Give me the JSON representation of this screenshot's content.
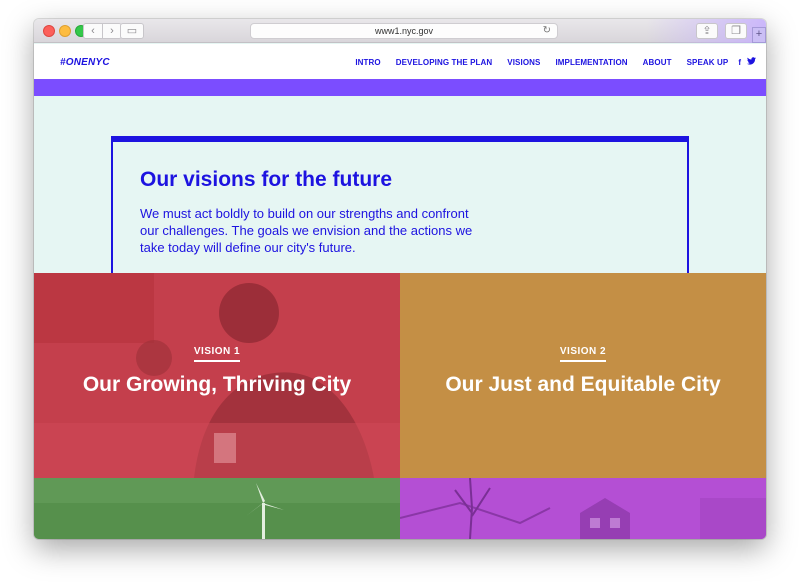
{
  "browser": {
    "url": "www1.nyc.gov"
  },
  "site": {
    "logo": "#ONENYC",
    "nav": [
      "INTRO",
      "DEVELOPING THE PLAN",
      "VISIONS",
      "IMPLEMENTATION",
      "ABOUT",
      "SPEAK UP"
    ],
    "social": {
      "facebook": "f",
      "twitter": "🐦"
    }
  },
  "intro": {
    "title": "Our visions for the future",
    "body": "We must act boldly to build on our strengths and confront our challenges. The goals we envision and the actions we take today will define our city's future."
  },
  "visions": [
    {
      "label": "VISION 1",
      "title": "Our Growing, Thriving City",
      "color": "#c43f4c"
    },
    {
      "label": "VISION 2",
      "title": "Our Just and Equitable City",
      "color": "#c48f45"
    },
    {
      "color": "#56904c"
    },
    {
      "color": "#b44fd4"
    }
  ],
  "colors": {
    "brand_blue": "#1d13e0",
    "purple_bar": "#7b4dff",
    "page_bg": "#e6f6f3"
  }
}
